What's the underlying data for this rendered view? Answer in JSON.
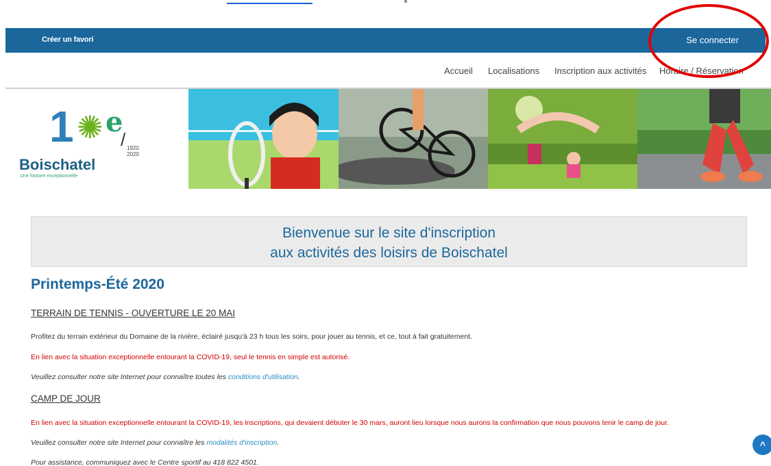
{
  "topbar": {
    "fav_label": "Créer un favori",
    "login_label": "Se connecter"
  },
  "nav": {
    "items": [
      {
        "label": "Accueil"
      },
      {
        "label": "Localisations"
      },
      {
        "label": "Inscription aux activités"
      },
      {
        "label": "Horaire / Réservation"
      }
    ]
  },
  "logo": {
    "hundred": "1",
    "e_mark": "e",
    "years": "1920\n2020",
    "name": "Boischatel",
    "tagline": "Une histoire exceptionnelle"
  },
  "welcome": {
    "line1": "Bienvenue sur le site d'inscription",
    "line2": "aux activités des loisirs de Boischatel"
  },
  "season_title": "Printemps-Été 2020",
  "sections": [
    {
      "heading": "TERRAIN DE TENNIS - OUVERTURE LE 20 MAI",
      "p1": "Profitez du terrain extérieur du Domaine de la rivière, éclairé jusqu'à 23 h tous les soirs, pour jouer au tennis, et ce, tout à fait gratuitement.",
      "p2": "En lien avec la situation exceptionnelle entourant la COVID-19, seul le tennis en simple est autorisé.",
      "p3_prefix": "Veuillez consulter notre site Internet pour connaître toutes les ",
      "p3_link": "conditions d'utilisation",
      "p3_suffix": "."
    },
    {
      "heading": "CAMP DE JOUR",
      "p1": "En lien avec la situation exceptionnelle entourant la COVID-19, les inscriptions, qui devaient débuter le 30 mars, auront lieu lorsque nous aurons la confirmation que nous pouvons tenir le camp de jour.",
      "p2_prefix": "Veuillez consulter notre site Internet pour connaître les ",
      "p2_link": "modalités d'inscription",
      "p2_suffix": ".",
      "p3": "Pour assistance, communiquez avec le Centre sportif au 418 822 4501."
    }
  ],
  "scroll_top": "^"
}
